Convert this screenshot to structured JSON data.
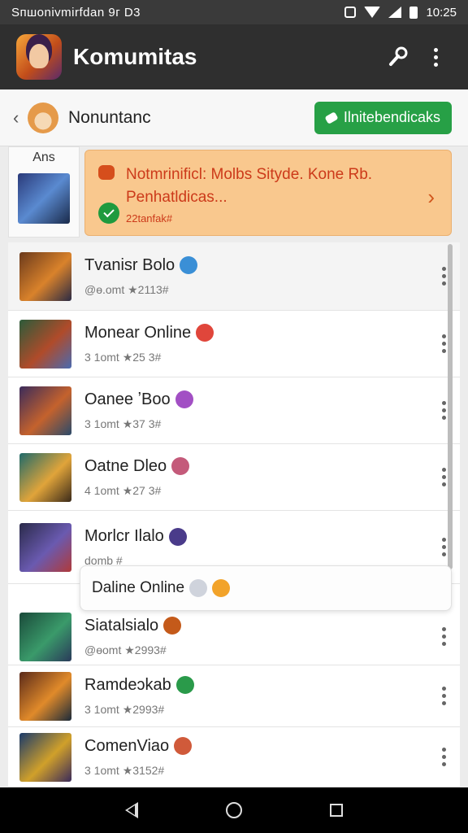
{
  "status_bar": {
    "left_text": "Sпшоnivmirfdan 9г D3",
    "time": "10:25"
  },
  "appbar": {
    "title": "Komumitas"
  },
  "subheader": {
    "title": "Nonuntanc",
    "button_label": "Ilnitebendicaks"
  },
  "left_card": {
    "label": "Ans"
  },
  "notice": {
    "line1": "Notmrinificl: Molbs Sityde. Kone Rb.",
    "line2": "Penhatldicas...",
    "meta": "22tanfak#"
  },
  "list": [
    {
      "name": "Tvanisr Bolo",
      "meta": "@ɵ.omt ★2113#",
      "badge_color": "#3a8fd6",
      "colors": [
        "#6b3a1c",
        "#d9822b",
        "#2a2a44"
      ],
      "selected": true
    },
    {
      "name": "Monear Online",
      "meta": "3 1omt ★25 3#",
      "badge_color": "#e0463b",
      "colors": [
        "#2c5b3a",
        "#b04b2a",
        "#4a6ab0"
      ]
    },
    {
      "name": "Oanee ʼBoo",
      "meta": "3 1omt ★37 3#",
      "badge_color": "#a24fc4",
      "colors": [
        "#3b2b5a",
        "#c4622d",
        "#2a4a6a"
      ]
    },
    {
      "name": "Oatne Dleo",
      "meta": "4 1omt ★27 3#",
      "badge_color": "#c45a7a",
      "colors": [
        "#1f6a6a",
        "#e0a43a",
        "#3a2a1a"
      ]
    },
    {
      "name": "Morlcr Ilalo",
      "meta": "domb #",
      "badge_color": "#4a3b8a",
      "colors": [
        "#2a2a4a",
        "#6a5ab0",
        "#b03a3a"
      ]
    },
    {
      "name": "Siatalsialo",
      "meta": "@ɵomt ★2993#",
      "badge_color": "#c45a1a",
      "colors": [
        "#1a4a3a",
        "#3a9a6a",
        "#2a3a5a"
      ]
    },
    {
      "name": "Ramdeɔkab",
      "meta": "3 1omt ★2993#",
      "badge_color": "#2a9a4a",
      "colors": [
        "#5a2a1a",
        "#e08a2a",
        "#1a2a3a"
      ]
    },
    {
      "name": "ComenViao",
      "meta": "3 1omt ★3152#",
      "badge_color": "#d05a3a",
      "colors": [
        "#1a3a6a",
        "#d0a02a",
        "#3a2a5a"
      ]
    }
  ],
  "popup": {
    "text": "Daline Online"
  },
  "colors": {
    "appbar": "#2f2f2f",
    "accent_green": "#27a046",
    "notice_bg": "#f9c88e",
    "notice_text": "#cc3a1a"
  }
}
